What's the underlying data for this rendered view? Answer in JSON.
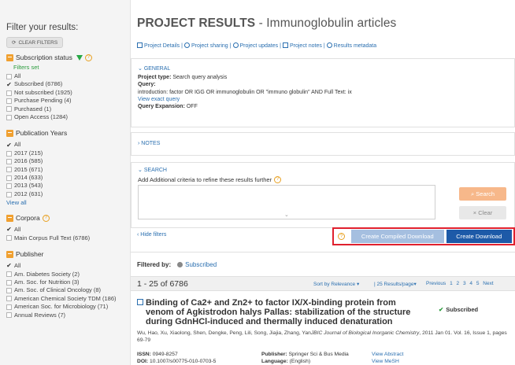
{
  "sidebar": {
    "title": "Filter your results:",
    "clear_filters": "CLEAR FILTERS",
    "subscription": {
      "heading": "Subscription status",
      "filters_set": "Filters set",
      "items": [
        {
          "label": "All",
          "checked": false
        },
        {
          "label": "Subscribed (6786)",
          "checked": true
        },
        {
          "label": "Not subscribed (1925)",
          "checked": false
        },
        {
          "label": "Purchase Pending (4)",
          "checked": false
        },
        {
          "label": "Purchased (1)",
          "checked": false
        },
        {
          "label": "Open Access (1284)",
          "checked": false
        }
      ]
    },
    "years": {
      "heading": "Publication Years",
      "items": [
        {
          "label": "All",
          "checked": true
        },
        {
          "label": "2017 (215)",
          "checked": false
        },
        {
          "label": "2016 (585)",
          "checked": false
        },
        {
          "label": "2015 (671)",
          "checked": false
        },
        {
          "label": "2014 (633)",
          "checked": false
        },
        {
          "label": "2013 (543)",
          "checked": false
        },
        {
          "label": "2012 (631)",
          "checked": false
        }
      ],
      "view_all": "View all"
    },
    "corpora": {
      "heading": "Corpora",
      "items": [
        {
          "label": "All",
          "checked": true
        },
        {
          "label": "Main Corpus Full Text (6786)",
          "checked": false
        }
      ]
    },
    "publisher": {
      "heading": "Publisher",
      "items": [
        {
          "label": "All",
          "checked": true
        },
        {
          "label": "Am. Diabetes Society (2)",
          "checked": false
        },
        {
          "label": "Am. Soc. for Nutrition (3)",
          "checked": false
        },
        {
          "label": "Am. Soc. of Clinical Oncology (8)",
          "checked": false
        },
        {
          "label": "American Chemical Society TDM (186)",
          "checked": false
        },
        {
          "label": "American Soc. for Microbiology (71)",
          "checked": false
        },
        {
          "label": "Annual Reviews (7)",
          "checked": false
        }
      ]
    }
  },
  "main": {
    "title": "PROJECT RESULTS",
    "title_sub": " - Immunoglobulin articles",
    "tabs": [
      "Project Details",
      "Project sharing",
      "Project updates",
      "Project notes",
      "Results metadata"
    ],
    "general": {
      "heading": "GENERAL",
      "project_type_label": "Project type:",
      "project_type": "Search query analysis",
      "query_label": "Query:",
      "query": "introduction: factor OR IGG OR immunoglobulin OR \"immuno globulin\" AND Full Text: ix",
      "view_exact": "View exact query",
      "expansion_label": "Query Expansion:",
      "expansion": "OFF"
    },
    "notes": {
      "heading": "NOTES"
    },
    "search": {
      "heading": "SEARCH",
      "add_criteria": "Add Additional criteria to refine these results further",
      "search_btn": "Search",
      "clear_btn": "Clear"
    },
    "hide_filters": "Hide filters",
    "create_compiled": "Create Compiled Download",
    "create_download": "Create Download",
    "filtered_by": "Filtered by:",
    "filter_tag": "Subscribed",
    "results_count": "1 - 25 of 6786",
    "sort": "Sort by Relevance",
    "per_page": "25 Results/page",
    "pager": {
      "previous": "Previous",
      "pages": [
        "1",
        "2",
        "3",
        "4",
        "5"
      ],
      "next": "Next"
    },
    "result": {
      "title": "Binding of Ca2+ and Zn2+ to factor IX/X-binding protein from venom of Agkistrodon halys Pallas: stabilization of the structure during GdnHCl-induced and thermally induced denaturation",
      "badge": "Subscribed",
      "authors": "Wu, Hao, Xu, Xiaolong, Shen, Dengke, Peng, Lili, Song, Jiajia, Zhang, Yan",
      "journal": "JBIC Journal of Biological Inorganic Chemistry",
      "citation": ", 2011 Jan 01. Vol. 16, Issue 1, pages 69-79",
      "issn_label": "ISSN:",
      "issn": "0949-8257",
      "doi_label": "DOI:",
      "doi": "10.1007/s00775-010-0703-5",
      "publisher_label": "Publisher:",
      "publisher": "Springer Sci & Bus Media",
      "language_label": "Language:",
      "language": "(English)",
      "view_abstract": "View Abstract",
      "view_mesh": "View MeSH"
    }
  }
}
